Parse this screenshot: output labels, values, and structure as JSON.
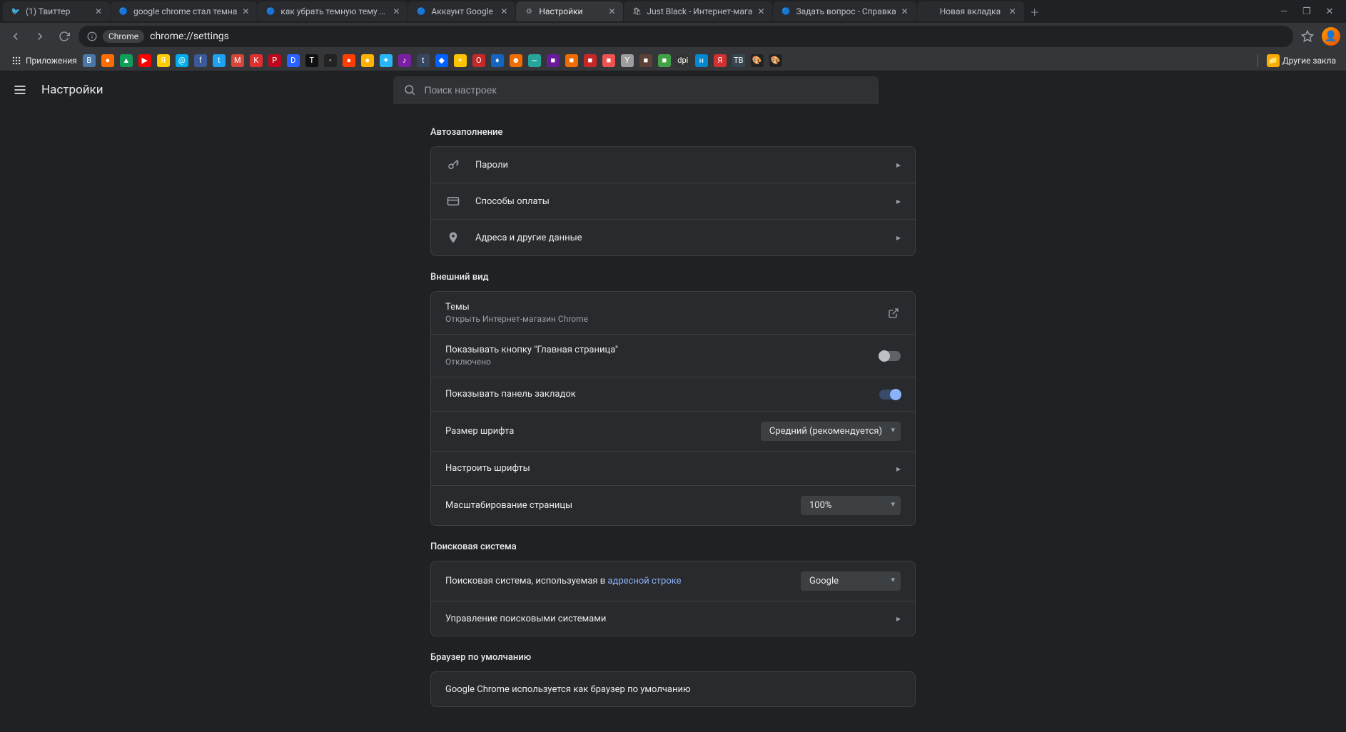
{
  "tabs": [
    {
      "title": "(1) Твиттер",
      "fav": "twitter",
      "active": false
    },
    {
      "title": "google chrome стал темна",
      "fav": "google",
      "active": false
    },
    {
      "title": "как убрать темную тему ch",
      "fav": "google",
      "active": false
    },
    {
      "title": "Аккаунт Google",
      "fav": "google",
      "active": false
    },
    {
      "title": "Настройки",
      "fav": "gear",
      "active": true
    },
    {
      "title": "Just Black - Интернет-мага",
      "fav": "store",
      "active": false
    },
    {
      "title": "Задать вопрос - Справка",
      "fav": "google",
      "active": false
    },
    {
      "title": "Новая вкладка",
      "fav": "",
      "active": false
    }
  ],
  "omnibox": {
    "chip_label": "Chrome",
    "url": "chrome://settings"
  },
  "bookmarks": {
    "apps_label": "Приложения",
    "other_label": "Другие закла",
    "items": [
      {
        "bg": "#4a76a8",
        "txt": "B"
      },
      {
        "bg": "#ff6d00",
        "txt": "●"
      },
      {
        "bg": "#0f9d58",
        "txt": "▲"
      },
      {
        "bg": "#ff0000",
        "txt": "▶"
      },
      {
        "bg": "#ffcc00",
        "txt": "Я"
      },
      {
        "bg": "#00aced",
        "txt": "@"
      },
      {
        "bg": "#3b5998",
        "txt": "f"
      },
      {
        "bg": "#1da1f2",
        "txt": "t"
      },
      {
        "bg": "#d44638",
        "txt": "M"
      },
      {
        "bg": "#e02f2f",
        "txt": "K"
      },
      {
        "bg": "#bd081c",
        "txt": "P"
      },
      {
        "bg": "#2962ff",
        "txt": "D"
      },
      {
        "bg": "#111",
        "txt": "T"
      },
      {
        "bg": "#222",
        "txt": "◦"
      },
      {
        "bg": "#ff3d00",
        "txt": "●"
      },
      {
        "bg": "#ffb300",
        "txt": "●"
      },
      {
        "bg": "#29b6f6",
        "txt": "✦"
      },
      {
        "bg": "#7b1fa2",
        "txt": "♪"
      },
      {
        "bg": "#36465d",
        "txt": "t"
      },
      {
        "bg": "#0061ff",
        "txt": "◆"
      },
      {
        "bg": "#ffc400",
        "txt": "+"
      },
      {
        "bg": "#c62828",
        "txt": "O"
      },
      {
        "bg": "#1565c0",
        "txt": "♦"
      },
      {
        "bg": "#ef6c00",
        "txt": "☻"
      },
      {
        "bg": "#26a69a",
        "txt": "~"
      },
      {
        "bg": "#6a1b9a",
        "txt": "■"
      },
      {
        "bg": "#ef6c00",
        "txt": "■"
      },
      {
        "bg": "#c62828",
        "txt": "■"
      },
      {
        "bg": "#ef5350",
        "txt": "■"
      },
      {
        "bg": "#9e9e9e",
        "txt": "Y"
      },
      {
        "bg": "#5d4037",
        "txt": "■"
      },
      {
        "bg": "#43a047",
        "txt": "■"
      },
      {
        "bg": "#333",
        "txt": "dpi"
      },
      {
        "bg": "#0288d1",
        "txt": "н"
      },
      {
        "bg": "#d32f2f",
        "txt": "Я"
      },
      {
        "bg": "#37474f",
        "txt": "ТВ"
      },
      {
        "bg": "#222",
        "txt": "🎨"
      },
      {
        "bg": "#222",
        "txt": "🎨"
      }
    ]
  },
  "app_bar": {
    "title": "Настройки",
    "search_placeholder": "Поиск настроек"
  },
  "sections": {
    "autofill_title": "Автозаполнение",
    "autofill_rows": [
      {
        "label": "Пароли",
        "icon": "key"
      },
      {
        "label": "Способы оплаты",
        "icon": "card"
      },
      {
        "label": "Адреса и другие данные",
        "icon": "pin"
      }
    ],
    "appearance_title": "Внешний вид",
    "themes": {
      "label": "Темы",
      "sub": "Открыть Интернет-магазин Chrome"
    },
    "home_btn": {
      "label": "Показывать кнопку \"Главная страница\"",
      "sub": "Отключено",
      "on": false
    },
    "bookmarks_bar": {
      "label": "Показывать панель закладок",
      "on": true
    },
    "font_size": {
      "label": "Размер шрифта",
      "value": "Средний (рекомендуется)"
    },
    "custom_fonts": {
      "label": "Настроить шрифты"
    },
    "page_zoom": {
      "label": "Масштабирование страницы",
      "value": "100%"
    },
    "search_title": "Поисковая система",
    "search_engine": {
      "prefix": "Поисковая система, используемая в ",
      "link": "адресной строке",
      "value": "Google"
    },
    "manage_search": {
      "label": "Управление поисковыми системами"
    },
    "default_browser_title": "Браузер по умолчанию",
    "default_browser_text": "Google Chrome используется как браузер по умолчанию"
  }
}
